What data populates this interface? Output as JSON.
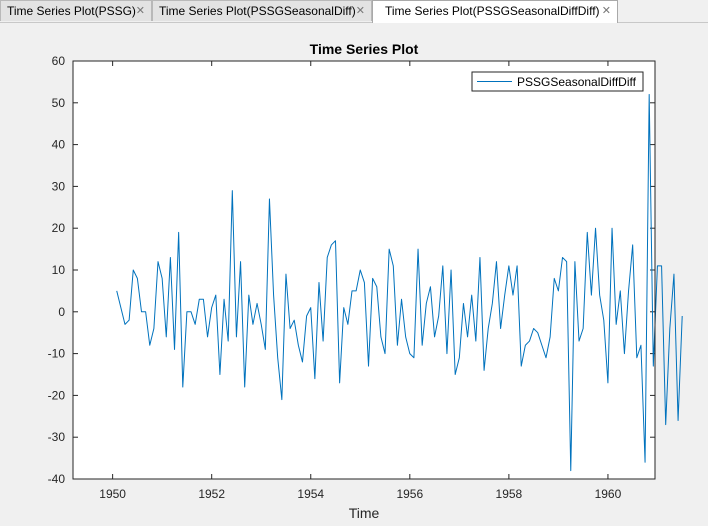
{
  "tabs": [
    {
      "label": "Time Series Plot(PSSG)",
      "close": "✕",
      "active": false
    },
    {
      "label": "Time Series Plot(PSSGSeasonalDiff)",
      "close": "✕",
      "active": false
    },
    {
      "label": "Time Series Plot(PSSGSeasonalDiffDiff)",
      "close": "✕",
      "active": true
    }
  ],
  "chart_data": {
    "type": "line",
    "title": "Time Series Plot",
    "xlabel": "Time",
    "ylabel": "",
    "xlim": [
      1949.2,
      1960.95
    ],
    "ylim": [
      -40,
      60
    ],
    "xticks": [
      1950,
      1952,
      1954,
      1956,
      1958,
      1960
    ],
    "yticks": [
      -40,
      -30,
      -20,
      -10,
      0,
      10,
      20,
      30,
      40,
      50,
      60
    ],
    "grid": false,
    "legend": "top-right",
    "line_color": "#0072BD",
    "series": [
      {
        "name": "PSSGSeasonalDiffDiff",
        "x_start": 1950.083,
        "x_step": 0.08333,
        "values": [
          5,
          1,
          -3,
          -2,
          10,
          8,
          0,
          0,
          -8,
          -4,
          12,
          8,
          -6,
          13,
          -9,
          19,
          -18,
          0,
          0,
          -3,
          3,
          3,
          -6,
          1,
          4,
          -15,
          3,
          -7,
          29,
          -6,
          12,
          -18,
          4,
          -3,
          2,
          -3,
          -9,
          27,
          4,
          -11,
          -21,
          9,
          -4,
          -2,
          -8,
          -12,
          -1,
          1,
          -16,
          7,
          -7,
          13,
          16,
          17,
          -17,
          1,
          -3,
          5,
          5,
          10,
          7,
          -13,
          8,
          6,
          -6,
          -10,
          15,
          11,
          -8,
          3,
          -6,
          -10,
          -11,
          15,
          -8,
          2,
          6,
          -6,
          -1,
          11,
          -10,
          10,
          -15,
          -11,
          2,
          -6,
          4,
          -7,
          13,
          -14,
          -4,
          2,
          12,
          -4,
          4,
          11,
          4,
          11,
          -13,
          -8,
          -7,
          -4,
          -5,
          -8,
          -11,
          -6,
          8,
          5,
          13,
          12,
          -38,
          12,
          -7,
          -4,
          19,
          4,
          20,
          4,
          -2,
          -17,
          20,
          -3,
          5,
          -10,
          5,
          16,
          -11,
          -8,
          -36,
          52,
          -13,
          11,
          11,
          -27,
          -4,
          9,
          -26,
          -1
        ]
      }
    ]
  }
}
